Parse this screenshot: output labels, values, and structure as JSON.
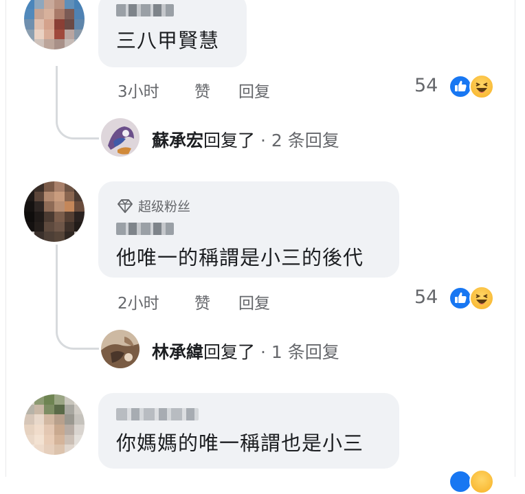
{
  "comments": [
    {
      "text": "三八甲賢慧",
      "time": "3小时",
      "like_label": "赞",
      "reply_label": "回复",
      "reaction_count": "54",
      "reaction_icons": [
        "like-icon",
        "haha-icon"
      ],
      "reply_summary": {
        "name": "蘇承宏",
        "verb": "回复了",
        "count": "· 2 条回复"
      }
    },
    {
      "badge": "超级粉丝",
      "badge_icon": "diamond-icon",
      "text": "他唯一的稱謂是小三的後代",
      "time": "2小时",
      "like_label": "赞",
      "reply_label": "回复",
      "reaction_count": "54",
      "reaction_icons": [
        "like-icon",
        "haha-icon"
      ],
      "reply_summary": {
        "name": "林承緯",
        "verb": "回复了",
        "count": "· 1 条回复"
      }
    },
    {
      "text": "你媽媽的唯一稱謂也是小三"
    }
  ],
  "colors": {
    "bubble": "#f0f2f5",
    "like_blue": "#1877f2",
    "haha_yellow": "#f7b125",
    "secondary_text": "#65676b"
  }
}
